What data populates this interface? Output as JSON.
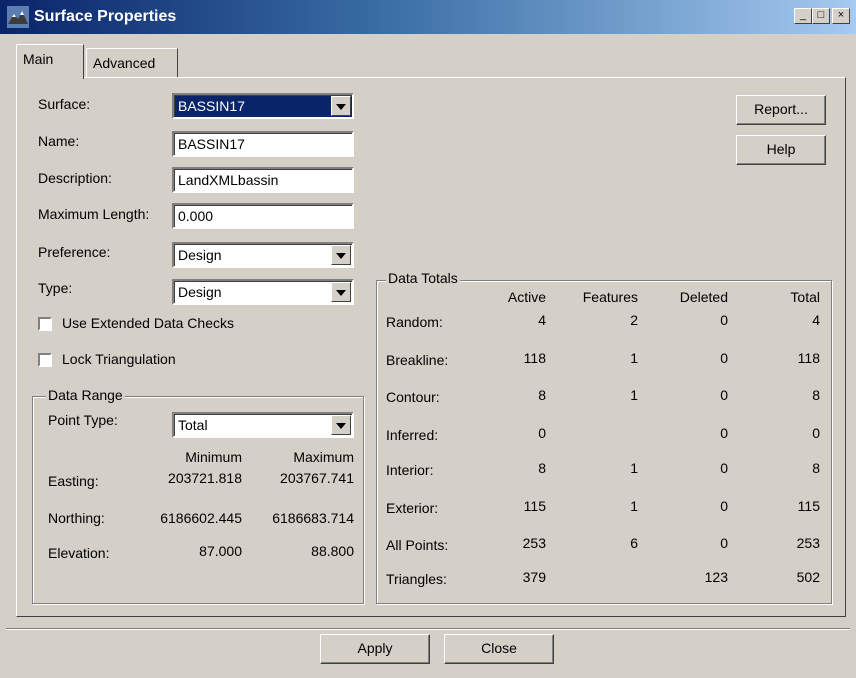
{
  "window": {
    "title": "Surface Properties",
    "minimize": "_",
    "maximize": "□",
    "close": "×"
  },
  "tabs": [
    {
      "label": "Main"
    },
    {
      "label": "Advanced"
    }
  ],
  "form": {
    "surface": {
      "label": "Surface:",
      "value": "BASSIN17"
    },
    "name": {
      "label": "Name:",
      "value": "BASSIN17"
    },
    "description": {
      "label": "Description:",
      "value": "LandXMLbassin"
    },
    "max_length": {
      "label": "Maximum Length:",
      "value": "0.000"
    },
    "preference": {
      "label": "Preference:",
      "value": "Design"
    },
    "type": {
      "label": "Type:",
      "value": "Design"
    },
    "extended_checks": {
      "label": "Use Extended Data Checks",
      "checked": false
    },
    "lock_triangulation": {
      "label": "Lock Triangulation",
      "checked": false
    }
  },
  "buttons": {
    "report": "Report...",
    "help": "Help",
    "apply": "Apply",
    "close": "Close"
  },
  "data_range": {
    "title": "Data Range",
    "point_type_label": "Point Type:",
    "point_type_value": "Total",
    "col_min": "Minimum",
    "col_max": "Maximum",
    "rows": [
      {
        "label": "Easting:",
        "min": "203721.818",
        "max": "203767.741"
      },
      {
        "label": "Northing:",
        "min": "6186602.445",
        "max": "6186683.714"
      },
      {
        "label": "Elevation:",
        "min": "87.000",
        "max": "88.800"
      }
    ]
  },
  "data_totals": {
    "title": "Data Totals",
    "columns": [
      "Active",
      "Features",
      "Deleted",
      "Total"
    ],
    "rows": [
      {
        "label": "Random:",
        "active": "4",
        "features": "2",
        "deleted": "0",
        "total": "4"
      },
      {
        "label": "Breakline:",
        "active": "118",
        "features": "1",
        "deleted": "0",
        "total": "118"
      },
      {
        "label": "Contour:",
        "active": "8",
        "features": "1",
        "deleted": "0",
        "total": "8"
      },
      {
        "label": "Inferred:",
        "active": "0",
        "features": "",
        "deleted": "0",
        "total": "0"
      },
      {
        "label": "Interior:",
        "active": "8",
        "features": "1",
        "deleted": "0",
        "total": "8"
      },
      {
        "label": "Exterior:",
        "active": "115",
        "features": "1",
        "deleted": "0",
        "total": "115"
      },
      {
        "label": "All Points:",
        "active": "253",
        "features": "6",
        "deleted": "0",
        "total": "253"
      },
      {
        "label": "Triangles:",
        "active": "379",
        "features": "",
        "deleted": "123",
        "total": "502"
      }
    ]
  }
}
